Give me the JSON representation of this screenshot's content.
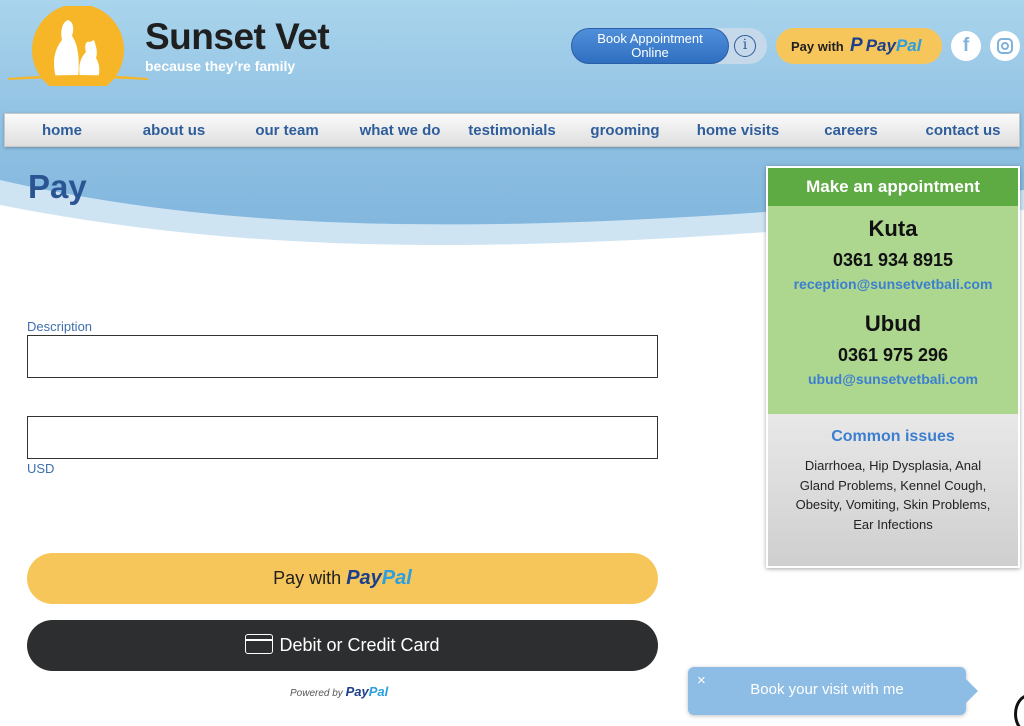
{
  "header": {
    "brand_title": "Sunset Vet",
    "brand_tagline": "because they’re family",
    "book_online_label": "Book Appointment Online",
    "paypal_top": {
      "pay_with": "Pay with",
      "paypal_a": "Pay",
      "paypal_b": "Pal"
    },
    "social": [
      {
        "name": "facebook-icon",
        "glyph": "f"
      },
      {
        "name": "instagram-icon"
      }
    ]
  },
  "nav": {
    "items": [
      {
        "label": "home"
      },
      {
        "label": "about us"
      },
      {
        "label": "our team"
      },
      {
        "label": "what we do"
      },
      {
        "label": "testimonials"
      },
      {
        "label": "grooming"
      },
      {
        "label": "home visits"
      },
      {
        "label": "careers"
      },
      {
        "label": "contact us"
      }
    ]
  },
  "page": {
    "title": "Pay"
  },
  "form": {
    "description_label": "Description",
    "description_value": "",
    "amount_value": "",
    "currency_label": "USD",
    "pay_button": {
      "pay_with": "Pay with",
      "paypal_a": "Pay",
      "paypal_b": "Pal"
    },
    "card_button_label": "Debit or Credit Card",
    "powered_by": "Powered by",
    "powered_paypal_a": "Pay",
    "powered_paypal_b": "Pal"
  },
  "appointment": {
    "heading": "Make an appointment",
    "locations": [
      {
        "name": "Kuta",
        "phone": "0361 934 8915",
        "email": "reception@sunsetvetbali.com"
      },
      {
        "name": "Ubud",
        "phone": "0361 975 296",
        "email": "ubud@sunsetvetbali.com"
      }
    ],
    "common_issues_title": "Common issues",
    "common_issues_body": "Diarrhoea, Hip Dysplasia, Anal Gland Problems, Kennel Cough, Obesity, Vomiting, Skin Problems, Ear Infections"
  },
  "chat": {
    "close_glyph": "×",
    "label": "Book your visit with me"
  },
  "colors": {
    "brand_blue": "#2a5592",
    "nav_text": "#2e5d9c",
    "paypal_yellow": "#f6c65a",
    "appointment_green": "#5eaa43",
    "appointment_light_green": "#add68e",
    "link_blue": "#3c7fd0"
  }
}
